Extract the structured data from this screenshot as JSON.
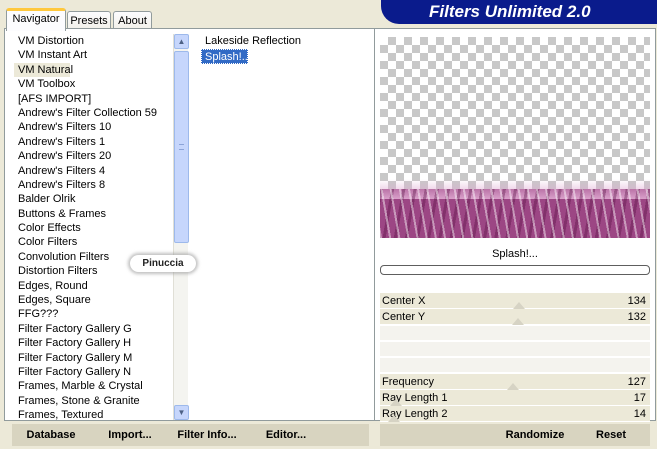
{
  "tabs": [
    {
      "label": "Navigator",
      "active": true
    },
    {
      "label": "Presets",
      "active": false
    },
    {
      "label": "About",
      "active": false
    }
  ],
  "header": {
    "title": "Filters Unlimited 2.0"
  },
  "categories": {
    "selected": "VM Natural",
    "items": [
      "VM Distortion",
      "VM Instant Art",
      "VM Natural",
      "VM Toolbox",
      "[AFS IMPORT]",
      "Andrew's Filter Collection 59",
      "Andrew's Filters 10",
      "Andrew's Filters 1",
      "Andrew's Filters 20",
      "Andrew's Filters 4",
      "Andrew's Filters 8",
      "Balder Olrik",
      "Buttons & Frames",
      "Color Effects",
      "Color Filters",
      "Convolution Filters",
      "Distortion Filters",
      "Edges, Round",
      "Edges, Square",
      "FFG???",
      "Filter Factory Gallery G",
      "Filter Factory Gallery H",
      "Filter Factory Gallery M",
      "Filter Factory Gallery N",
      "Frames, Marble & Crystal",
      "Frames, Stone & Granite",
      "Frames, Textured"
    ]
  },
  "filters": {
    "selected": "Splash!...",
    "items": [
      "Lakeside Reflection",
      "Splash!..."
    ]
  },
  "preview": {
    "effect_name": "Splash!...",
    "band_color": "#9c4684"
  },
  "sliders": {
    "center_x": {
      "label": "Center X",
      "value": "134"
    },
    "center_y": {
      "label": "Center Y",
      "value": "132"
    },
    "frequency": {
      "label": "Frequency",
      "value": "127"
    },
    "ray_length_1": {
      "label": "Ray Length 1",
      "value": "17"
    },
    "ray_length_2": {
      "label": "Ray Length 2",
      "value": "14"
    }
  },
  "buttons": {
    "database": "Database",
    "import": "Import...",
    "filter_info": "Filter Info...",
    "editor": "Editor...",
    "randomize": "Randomize",
    "reset": "Reset"
  },
  "watermark": "Pinuccia",
  "colors": {
    "banner": "#0a1b8c",
    "selection": "#316ac5",
    "tab_highlight": "#ffc83c"
  }
}
